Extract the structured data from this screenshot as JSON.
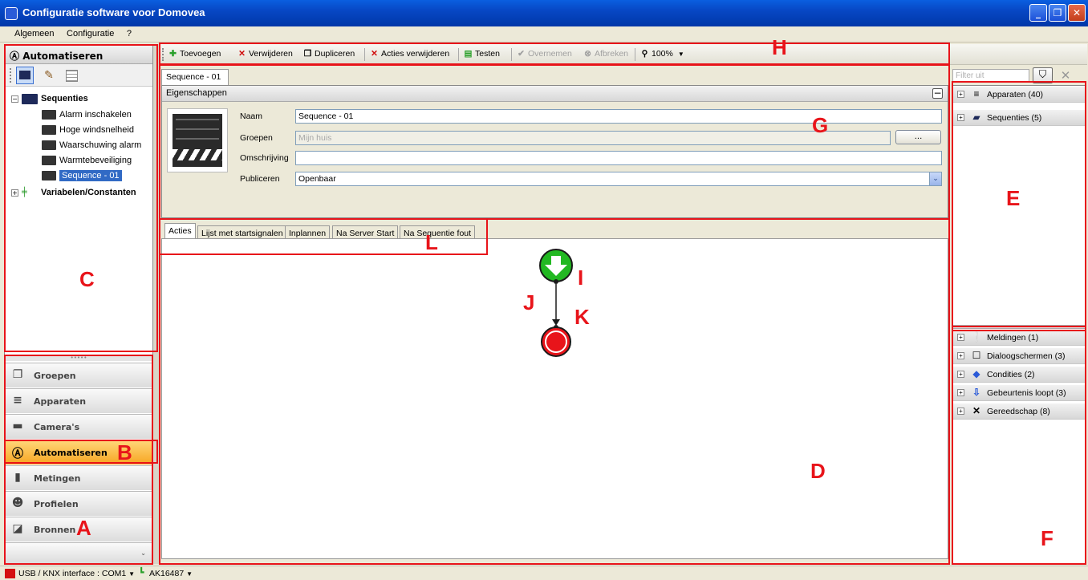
{
  "window": {
    "title": "Configuratie software voor Domovea",
    "controls": [
      "_",
      "❐",
      "✕"
    ]
  },
  "menubar": [
    "Algemeen",
    "Configuratie",
    "?"
  ],
  "leftpanel": {
    "header": "Automatiseren",
    "tree": {
      "sequences_label": "Sequenties",
      "sequences": [
        "Alarm inschakelen",
        "Hoge windsnelheid",
        "Waarschuwing alarm",
        "Warmtebeveiliging",
        "Sequence - 01"
      ],
      "selected": "Sequence - 01",
      "variables_label": "Variabelen/Constanten"
    },
    "nav": [
      {
        "label": "Groepen",
        "icon": "groups-icon"
      },
      {
        "label": "Apparaten",
        "icon": "devices-icon"
      },
      {
        "label": "Camera's",
        "icon": "camera-icon"
      },
      {
        "label": "Automatiseren",
        "icon": "automation-icon",
        "active": true
      },
      {
        "label": "Metingen",
        "icon": "meter-icon"
      },
      {
        "label": "Profielen",
        "icon": "profiles-icon"
      },
      {
        "label": "Bronnen",
        "icon": "sources-icon"
      }
    ]
  },
  "toolbar": {
    "add": "Toevoegen",
    "remove": "Verwijderen",
    "duplicate": "Dupliceren",
    "remove_actions": "Acties verwijderen",
    "test": "Testen",
    "apply": "Overnemen",
    "cancel": "Afbreken",
    "zoom": "100%"
  },
  "document": {
    "tab": "Sequence - 01",
    "properties": {
      "header": "Eigenschappen",
      "name_label": "Naam",
      "name_value": "Sequence - 01",
      "groups_label": "Groepen",
      "groups_value": "Mijn huis",
      "groups_button": "...",
      "description_label": "Omschrijving",
      "description_value": "",
      "publish_label": "Publiceren",
      "publish_value": "Openbaar"
    },
    "tabs": [
      "Acties",
      "Lijst met startsignalen",
      "Inplannen",
      "Na Server Start",
      "Na Sequentie fout"
    ],
    "active_tab": "Acties"
  },
  "rightpanel": {
    "filter_placeholder": "Filter uit",
    "top": [
      {
        "label": "Apparaten (40)",
        "icon": "devices-icon"
      },
      {
        "label": "Sequenties (5)",
        "icon": "sequences-icon"
      }
    ],
    "bottom": [
      {
        "label": "Meldingen (1)",
        "icon": "notification-icon"
      },
      {
        "label": "Dialoogschermen (3)",
        "icon": "dialog-icon"
      },
      {
        "label": "Condities (2)",
        "icon": "condition-icon"
      },
      {
        "label": "Gebeurtenis loopt (3)",
        "icon": "event-icon"
      },
      {
        "label": "Gereedschap (8)",
        "icon": "tools-icon"
      }
    ]
  },
  "statusbar": {
    "interface": "USB / KNX interface : COM1",
    "device": "AK16487"
  },
  "annotations": [
    "A",
    "B",
    "C",
    "D",
    "E",
    "F",
    "G",
    "H",
    "I",
    "J",
    "K",
    "L"
  ],
  "colors": {
    "annotation": "#e8141a",
    "selection": "#316ac5",
    "active_nav": "#f7a520",
    "start_node": "#22b822",
    "end_node": "#e8141a"
  }
}
